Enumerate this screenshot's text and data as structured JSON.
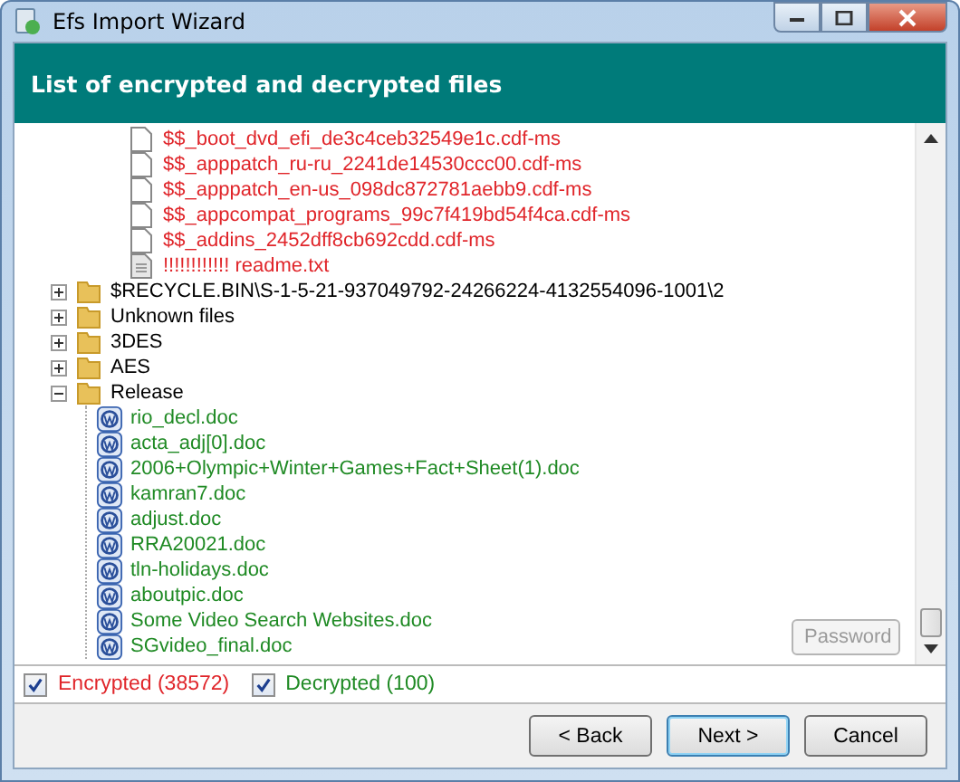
{
  "window": {
    "title": "Efs Import Wizard"
  },
  "header": {
    "title": "List of encrypted and decrypted files"
  },
  "tree": {
    "partial_branch": [
      {
        "kind": "file",
        "name": "$$_boot_dvd_efi_de3c4ceb32549e1c.cdf-ms",
        "encrypted": true
      },
      {
        "kind": "file",
        "name": "$$_apppatch_ru-ru_2241de14530ccc00.cdf-ms",
        "encrypted": true
      },
      {
        "kind": "file",
        "name": "$$_apppatch_en-us_098dc872781aebb9.cdf-ms",
        "encrypted": true
      },
      {
        "kind": "file",
        "name": "$$_appcompat_programs_99c7f419bd54f4ca.cdf-ms",
        "encrypted": true
      },
      {
        "kind": "file",
        "name": "$$_addins_2452dff8cb692cdd.cdf-ms",
        "encrypted": true
      },
      {
        "kind": "text",
        "name": "!!!!!!!!!!!! readme.txt",
        "encrypted": true
      }
    ],
    "items": [
      {
        "kind": "folder",
        "name": "$RECYCLE.BIN\\S-1-5-21-937049792-24266224-4132554096-1001\\2",
        "expanded": false
      },
      {
        "kind": "folder",
        "name": "Unknown files",
        "expanded": false
      },
      {
        "kind": "folder",
        "name": "3DES",
        "expanded": false
      },
      {
        "kind": "folder",
        "name": "AES",
        "expanded": false
      },
      {
        "kind": "folder",
        "name": "Release",
        "expanded": true,
        "children": [
          {
            "kind": "doc",
            "name": "rio_decl.doc",
            "encrypted": false
          },
          {
            "kind": "doc",
            "name": "acta_adj[0].doc",
            "encrypted": false
          },
          {
            "kind": "doc",
            "name": "2006+Olympic+Winter+Games+Fact+Sheet(1).doc",
            "encrypted": false
          },
          {
            "kind": "doc",
            "name": "kamran7.doc",
            "encrypted": false
          },
          {
            "kind": "doc",
            "name": "adjust.doc",
            "encrypted": false
          },
          {
            "kind": "doc",
            "name": "RRA20021.doc",
            "encrypted": false
          },
          {
            "kind": "doc",
            "name": "tln-holidays.doc",
            "encrypted": false
          },
          {
            "kind": "doc",
            "name": "aboutpic.doc",
            "encrypted": false
          },
          {
            "kind": "doc",
            "name": "Some Video Search Websites.doc",
            "encrypted": false
          },
          {
            "kind": "doc",
            "name": "SGvideo_final.doc",
            "encrypted": false
          }
        ]
      }
    ]
  },
  "password_button": {
    "label": "Password",
    "disabled": true
  },
  "filters": [
    {
      "label": "Encrypted (38572)",
      "checked": true,
      "encrypted": true
    },
    {
      "label": "Decrypted (100)",
      "checked": true,
      "encrypted": false
    }
  ],
  "buttons": [
    {
      "label": "< Back",
      "default": false
    },
    {
      "label": "Next >",
      "default": true
    },
    {
      "label": "Cancel",
      "default": false
    }
  ]
}
